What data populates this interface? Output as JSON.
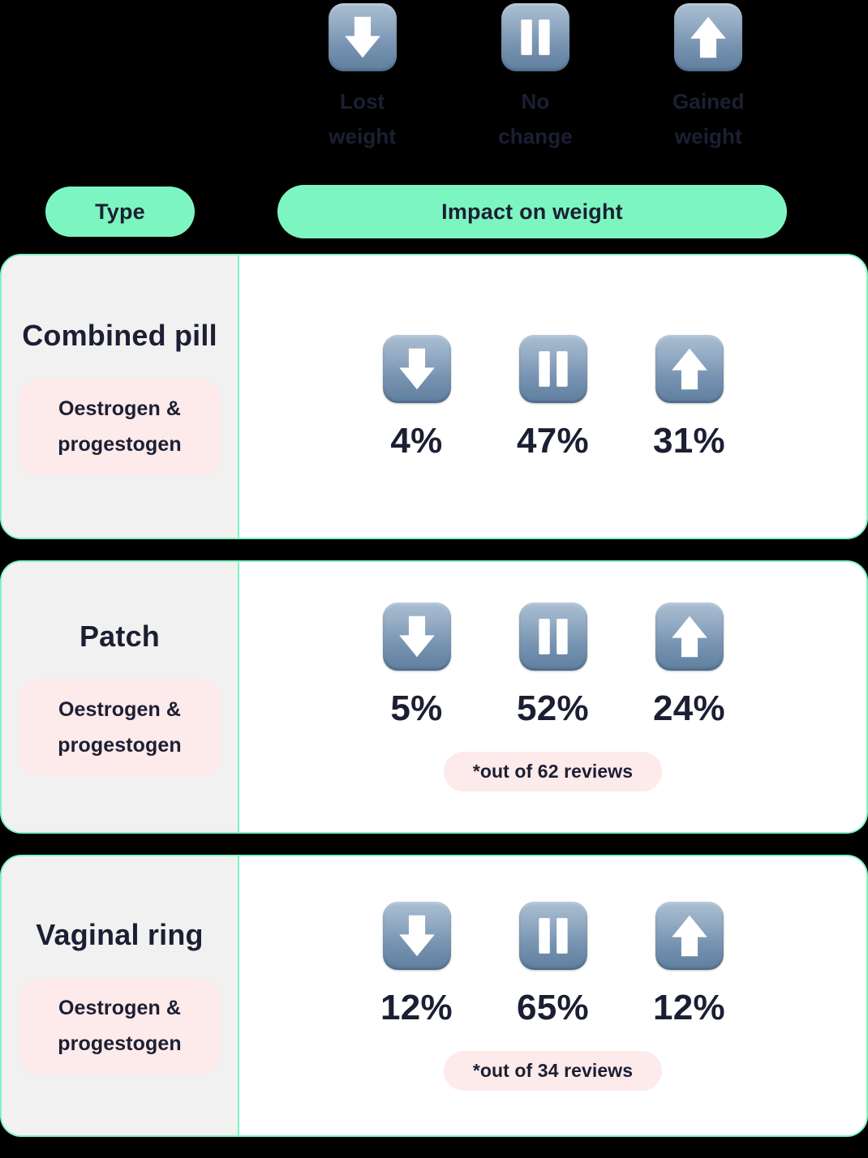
{
  "legend": {
    "items": [
      {
        "icon": "arrow-down-icon",
        "label": "Lost weight"
      },
      {
        "icon": "pause-icon",
        "label": "No change"
      },
      {
        "icon": "arrow-up-icon",
        "label": "Gained weight"
      }
    ]
  },
  "headers": {
    "type_label": "Type",
    "impact_label": "Impact on weight"
  },
  "colors": {
    "background": "#000000",
    "accent_green": "#7DF5C0",
    "text_dark": "#1C1F33",
    "pink_pill": "#FDEAEA",
    "grey_cell": "#F1F1F1",
    "icon_top": "#A9BED2",
    "icon_bottom": "#5F7E9E"
  },
  "rows": [
    {
      "type": "Combined pill",
      "hormone": "Oestrogen & progestogen",
      "lost": "4%",
      "no_change": "47%",
      "gained": "31%",
      "note": ""
    },
    {
      "type": "Patch",
      "hormone": "Oestrogen & progestogen",
      "lost": "5%",
      "no_change": "52%",
      "gained": "24%",
      "note": "*out of 62 reviews"
    },
    {
      "type": "Vaginal ring",
      "hormone": "Oestrogen & progestogen",
      "lost": "12%",
      "no_change": "65%",
      "gained": "12%",
      "note": "*out of 34 reviews"
    }
  ],
  "chart_data": {
    "type": "table",
    "title": "Impact on weight",
    "categories": [
      "Lost weight",
      "No change",
      "Gained weight"
    ],
    "series": [
      {
        "name": "Combined pill",
        "values": [
          4,
          47,
          31
        ]
      },
      {
        "name": "Patch",
        "values": [
          5,
          52,
          24
        ]
      },
      {
        "name": "Vaginal ring",
        "values": [
          12,
          65,
          12
        ]
      }
    ],
    "units": "percent",
    "annotations": [
      "*out of 62 reviews",
      "*out of 34 reviews"
    ]
  }
}
